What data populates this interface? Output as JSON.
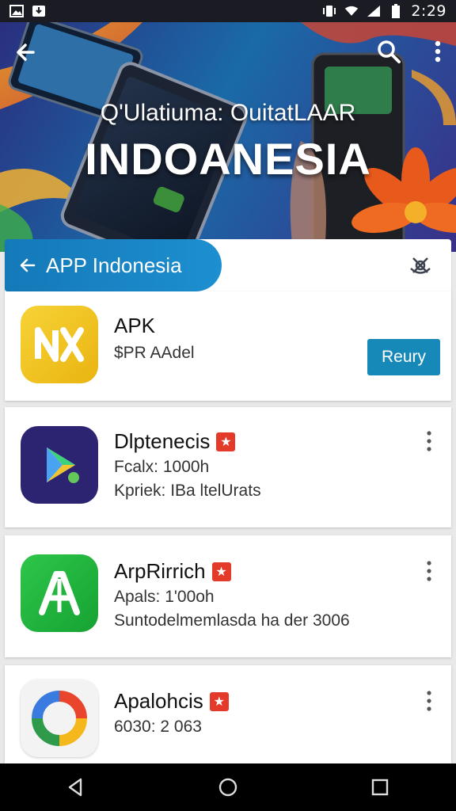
{
  "status_bar": {
    "time": "2:29",
    "icons": [
      "image-icon",
      "download-icon",
      "vibrate-icon",
      "wifi-icon",
      "signal-icon",
      "battery-icon"
    ]
  },
  "hero": {
    "subtitle": "Q'Ulatiuma: OuitatLAAR",
    "title": "INDOANESIA",
    "icons": [
      "back-arrow-icon",
      "search-icon",
      "more-vert-icon"
    ]
  },
  "section": {
    "label": "APP Indonesia",
    "icons": [
      "back-arrow-icon",
      "satellite-icon"
    ]
  },
  "apps": [
    {
      "name": "APK",
      "line1": "$PR AAdel",
      "button": "Reury",
      "icon": "nx-logo-icon",
      "color": "#f3c21c"
    },
    {
      "name": "Dlptenecis",
      "line1": "Fcalx: 1000h",
      "line2": "Kpriek: IBa ltelUrats",
      "icon": "play-icon",
      "color": "#2c2470"
    },
    {
      "name": "ArpRirrich",
      "line1": "Apals: 1'00oh",
      "line2": "Suntodelmemlasda ha der 3006",
      "icon": "a-logo-icon",
      "color": "#20b33a"
    },
    {
      "name": "Apalohcis",
      "line1": "6030: 2 063",
      "icon": "ring-logo-icon",
      "color": "#f2f2f2"
    }
  ],
  "nav_bar": {
    "icons": [
      "back-triangle-icon",
      "home-circle-icon",
      "recents-square-icon"
    ]
  }
}
